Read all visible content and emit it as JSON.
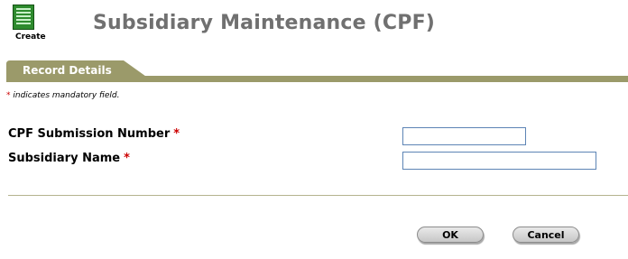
{
  "toolbar": {
    "create_label": "Create",
    "create_icon": "create-document-icon"
  },
  "header": {
    "title": "Subsidiary Maintenance (CPF)"
  },
  "tab": {
    "label": "Record Details"
  },
  "form": {
    "mandatory_asterisk": "*",
    "mandatory_note": "indicates mandatory field.",
    "fields": [
      {
        "label": "CPF Submission Number",
        "required_marker": "*",
        "value": ""
      },
      {
        "label": "Subsidiary Name",
        "required_marker": "*",
        "value": ""
      }
    ]
  },
  "buttons": {
    "ok": "OK",
    "cancel": "Cancel"
  },
  "colors": {
    "title": "#707070",
    "tab": "#9b9a6a",
    "icon_green": "#2e8b2e",
    "required": "#cc0000",
    "input_border": "#5d84b5"
  }
}
